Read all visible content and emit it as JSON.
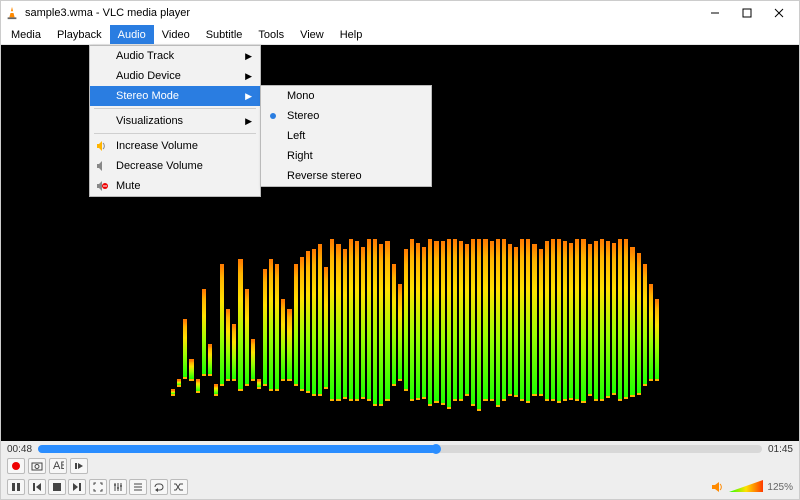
{
  "title": "sample3.wma - VLC media player",
  "menubar": [
    "Media",
    "Playback",
    "Audio",
    "Video",
    "Subtitle",
    "Tools",
    "View",
    "Help"
  ],
  "menubar_open_index": 2,
  "audio_menu": {
    "items": [
      {
        "label": "Audio Track",
        "submenu": true
      },
      {
        "label": "Audio Device",
        "submenu": true
      },
      {
        "label": "Stereo Mode",
        "submenu": true,
        "highlight": true
      },
      {
        "sep": true
      },
      {
        "label": "Visualizations",
        "submenu": true
      },
      {
        "sep": true
      },
      {
        "label": "Increase Volume",
        "icon": "vol-up"
      },
      {
        "label": "Decrease Volume",
        "icon": "vol-down"
      },
      {
        "label": "Mute",
        "icon": "mute"
      }
    ]
  },
  "stereo_menu": {
    "items": [
      {
        "label": "Mono"
      },
      {
        "label": "Stereo",
        "selected": true
      },
      {
        "label": "Left"
      },
      {
        "label": "Right"
      },
      {
        "label": "Reverse stereo"
      }
    ]
  },
  "time_current": "00:48",
  "time_total": "01:45",
  "volume_percent": "125%",
  "viz_bars": [
    5,
    6,
    58,
    20,
    12,
    85,
    30,
    10,
    120,
    70,
    55,
    130,
    95,
    40,
    8,
    115,
    130,
    125,
    80,
    70,
    120,
    132,
    140,
    145,
    150,
    120,
    160,
    155,
    148,
    160,
    158,
    150,
    160,
    165,
    160,
    158,
    120,
    95,
    140,
    160,
    155,
    150,
    165,
    160,
    162,
    168,
    160,
    158,
    150,
    165,
    170,
    160,
    158,
    166,
    160,
    150,
    148,
    160,
    162,
    150,
    145,
    158,
    160,
    162,
    158,
    155,
    160,
    162,
    150,
    158,
    160,
    155,
    150,
    160,
    158,
    148,
    140,
    120,
    95,
    80
  ],
  "viz_caps": [
    50,
    60,
    120,
    80,
    60,
    150,
    95,
    55,
    175,
    130,
    115,
    180,
    150,
    100,
    60,
    170,
    180,
    175,
    140,
    130,
    175,
    182,
    188,
    190,
    195,
    172,
    200,
    195,
    190,
    200,
    198,
    192,
    200,
    200,
    195,
    198,
    175,
    155,
    190,
    200,
    196,
    192,
    200,
    198,
    198,
    200,
    200,
    198,
    195,
    200,
    200,
    200,
    198,
    200,
    200,
    195,
    192,
    200,
    200,
    195,
    190,
    198,
    200,
    200,
    198,
    196,
    200,
    200,
    195,
    198,
    200,
    198,
    196,
    200,
    200,
    192,
    186,
    175,
    155,
    140
  ]
}
